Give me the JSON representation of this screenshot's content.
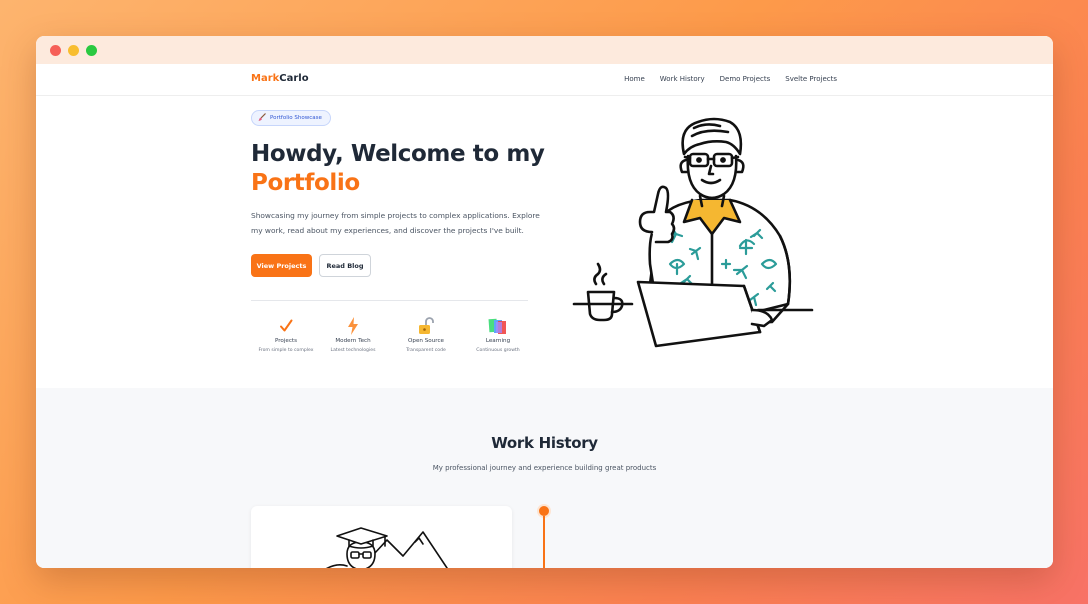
{
  "colors": {
    "accent": "#f97316",
    "text": "#1f2937",
    "badge_bg": "#eef3ff"
  },
  "nav": {
    "logo_part1": "Mark",
    "logo_part2": "Carlo",
    "links": [
      "Home",
      "Work History",
      "Demo Projects",
      "Svelte Projects"
    ]
  },
  "hero": {
    "badge_icon": "paintbrush-icon",
    "badge": "Portfolio Showcase",
    "headline_line1": "Howdy, Welcome to my",
    "headline_accent": "Portfolio",
    "intro": "Showcasing my journey from simple projects to complex applications. Explore my work, read about my experiences, and discover the projects I've built.",
    "primary_button": "View Projects",
    "secondary_button": "Read Blog",
    "features": [
      {
        "icon": "checkmark-icon",
        "title": "Projects",
        "subtitle": "From simple to complex"
      },
      {
        "icon": "lightning-icon",
        "title": "Modern Tech",
        "subtitle": "Latest technologies"
      },
      {
        "icon": "unlocked-padlock-icon",
        "title": "Open Source",
        "subtitle": "Transparent code"
      },
      {
        "icon": "books-icon",
        "title": "Learning",
        "subtitle": "Continuous growth"
      }
    ]
  },
  "work_history": {
    "title": "Work History",
    "subtitle": "My professional journey and experience building great products"
  }
}
